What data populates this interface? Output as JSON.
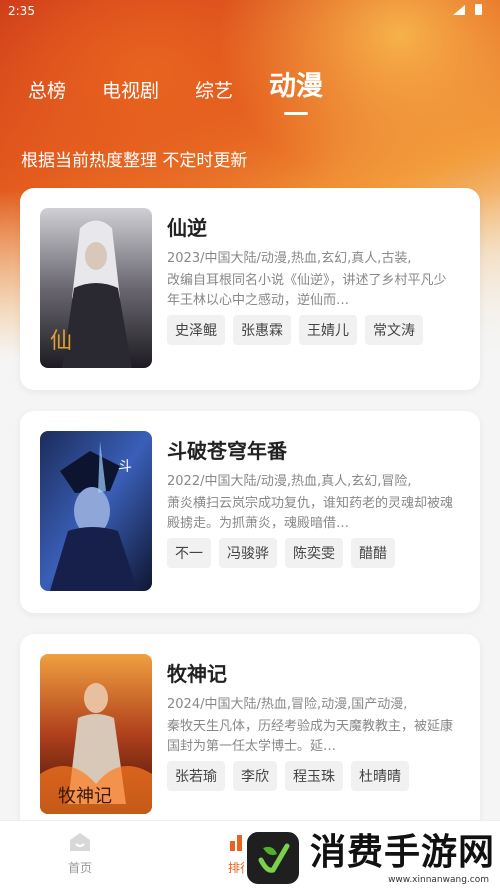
{
  "status_bar": {
    "time": "2:35"
  },
  "tabs": [
    {
      "label": "总榜"
    },
    {
      "label": "电视剧"
    },
    {
      "label": "综艺"
    },
    {
      "label": "动漫",
      "active": true
    }
  ],
  "subtitle": "根据当前热度整理 不定时更新",
  "cards": [
    {
      "title": "仙逆",
      "meta": "2023/中国大陆/动漫,热血,玄幻,真人,古装,",
      "desc": "改编自耳根同名小说《仙逆》，讲述了乡村平凡少年王林以心中之感动，逆仙而…",
      "tags": [
        "史泽鲲",
        "张惠霖",
        "王婧儿",
        "常文涛"
      ]
    },
    {
      "title": "斗破苍穹年番",
      "meta": "2022/中国大陆/动漫,热血,真人,玄幻,冒险,",
      "desc": "萧炎横扫云岚宗成功复仇，谁知药老的灵魂却被魂殿掳走。为抓萧炎，魂殿暗借…",
      "tags": [
        "不一",
        "冯骏骅",
        "陈奕雯",
        "醋醋"
      ]
    },
    {
      "title": "牧神记",
      "meta": "2024/中国大陆/热血,冒险,动漫,国产动漫,",
      "desc": "秦牧天生凡体，历经考验成为天魔教教主，被延康国封为第一任太学博士。延…",
      "tags": [
        "张若瑜",
        "李欣",
        "程玉珠",
        "杜晴晴"
      ]
    }
  ],
  "bottom_nav": {
    "home_label": "首页",
    "rank_label": "排行"
  },
  "watermark": {
    "title": "消费手游网",
    "url": "www.xinnanwang.com"
  },
  "colors": {
    "accent": "#e8631f"
  }
}
